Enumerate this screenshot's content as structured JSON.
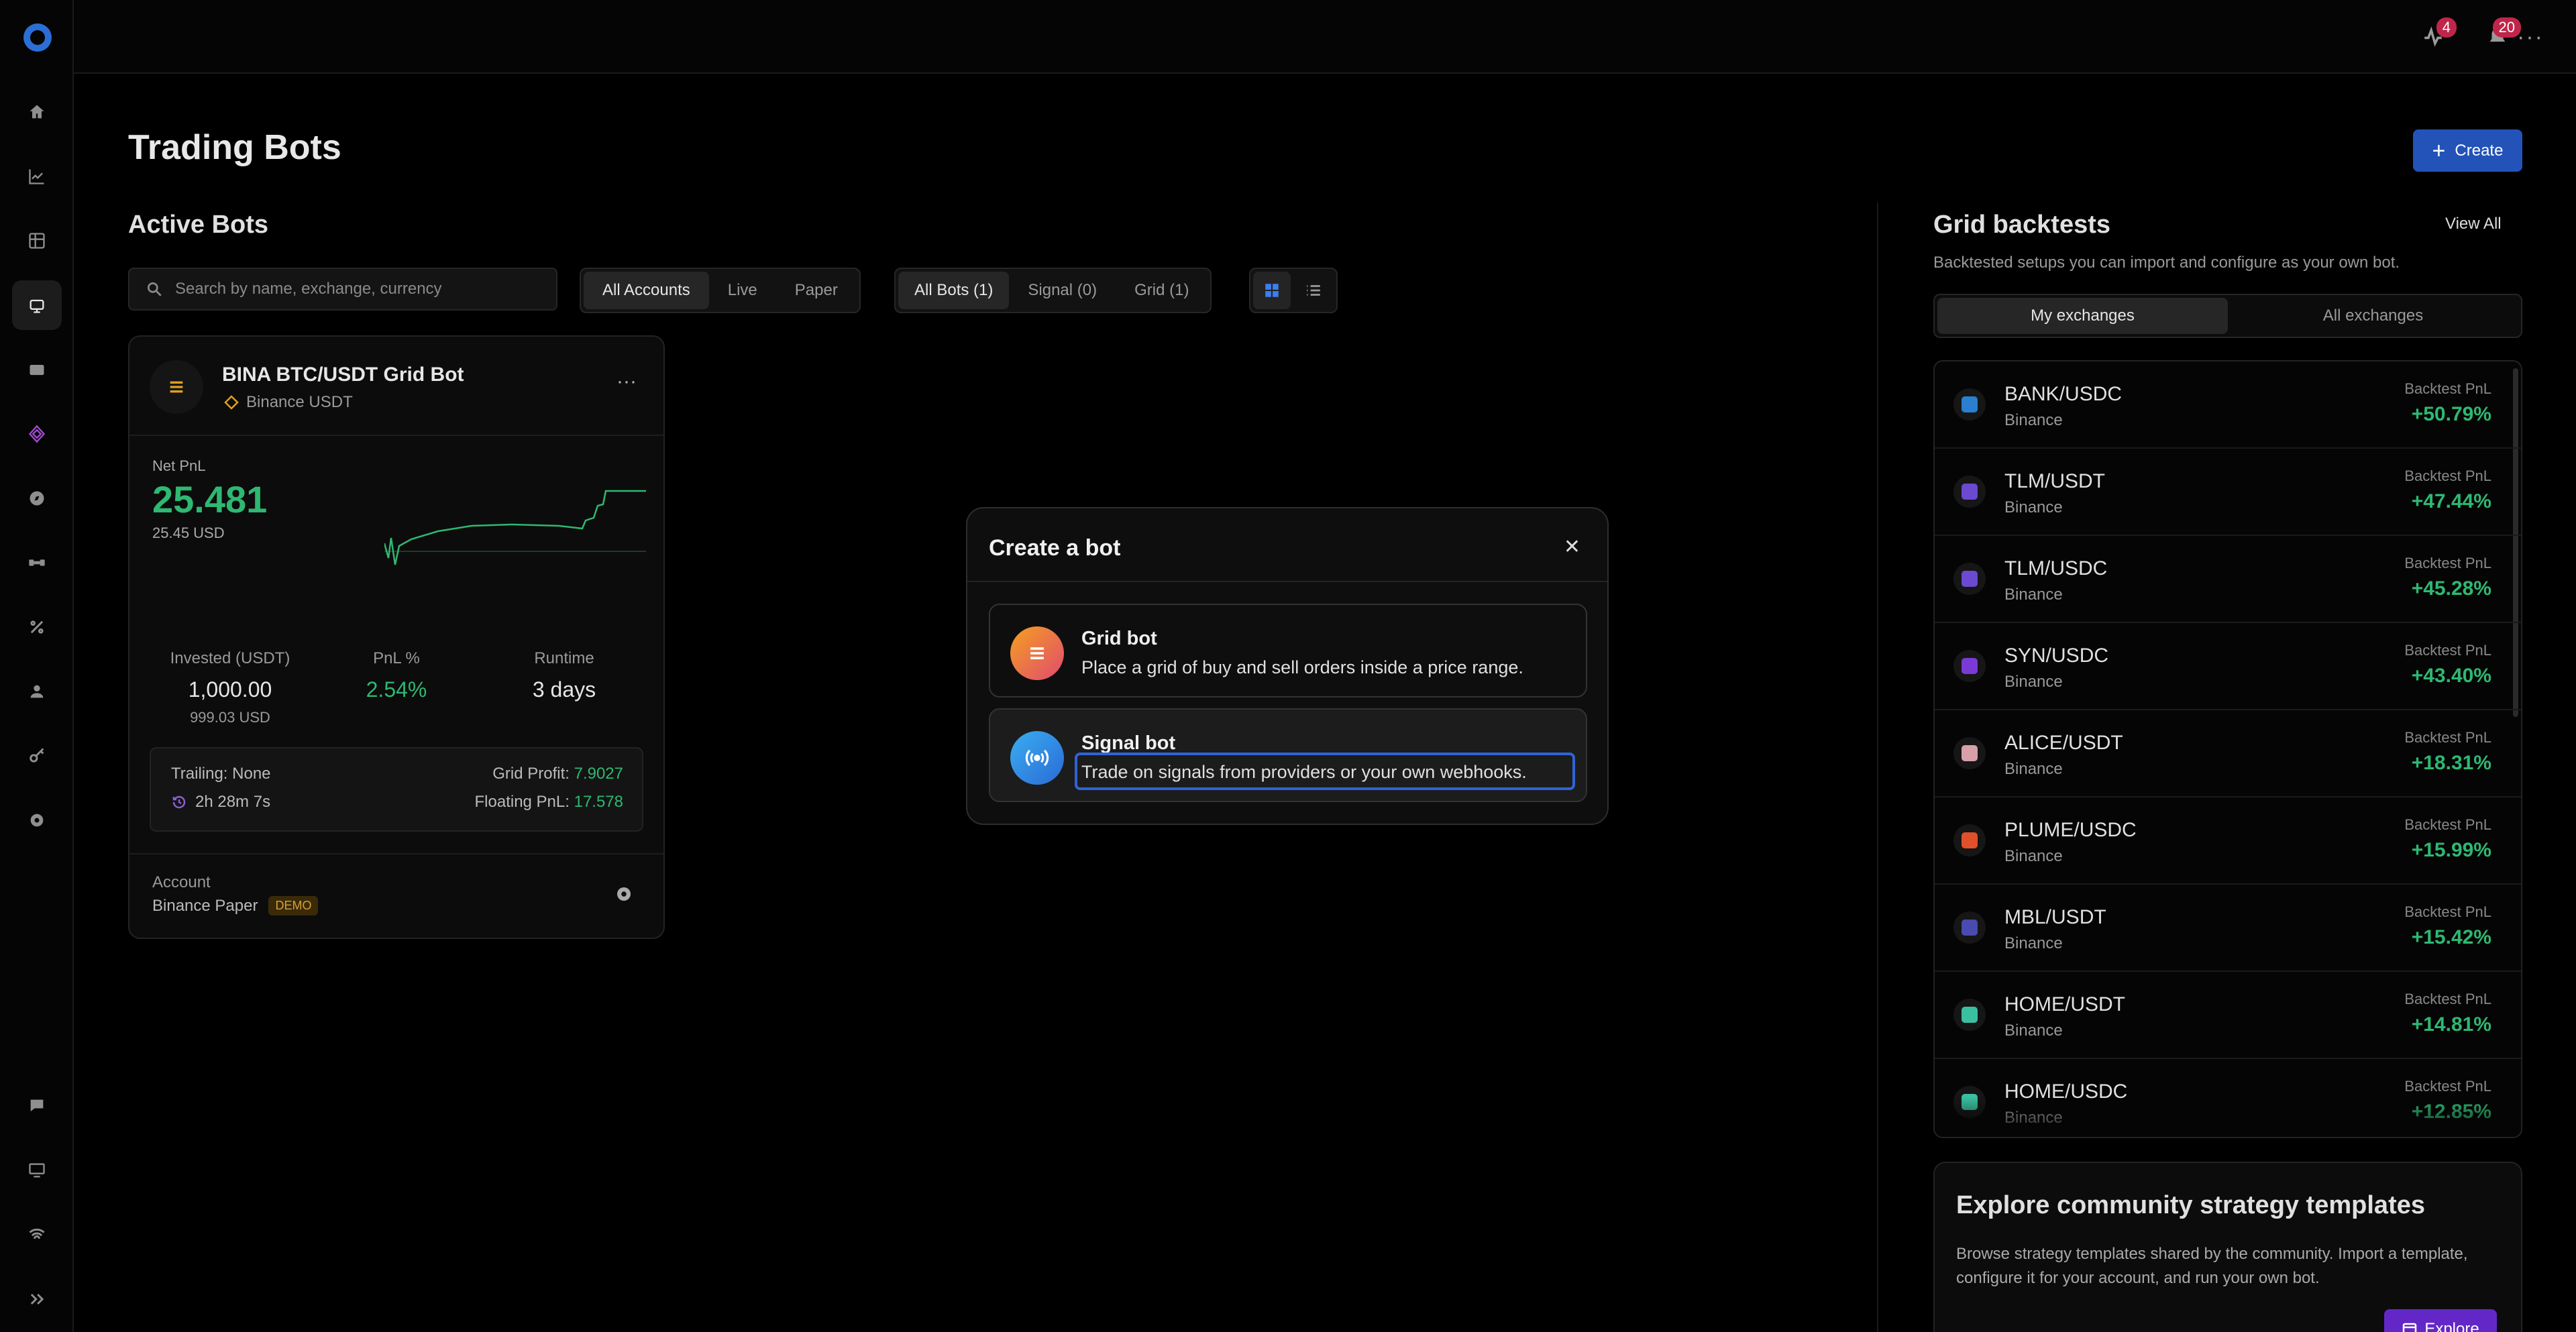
{
  "topbar": {
    "notifications_badge": "4",
    "alerts_badge": "20",
    "more_label": "···"
  },
  "sidebar": {
    "items": [
      {
        "icon": "home-icon"
      },
      {
        "icon": "chart-icon"
      },
      {
        "icon": "grid-icon"
      },
      {
        "icon": "bot-icon",
        "active": true
      },
      {
        "icon": "wallet-icon"
      },
      {
        "icon": "diamond-icon"
      },
      {
        "icon": "compass-icon"
      },
      {
        "icon": "handshake-icon"
      },
      {
        "icon": "percent-icon"
      },
      {
        "icon": "user-icon"
      },
      {
        "icon": "key-icon"
      },
      {
        "icon": "gear-icon"
      }
    ],
    "bottom": [
      {
        "icon": "chat-icon"
      },
      {
        "icon": "monitor-icon"
      },
      {
        "icon": "wifi-icon"
      },
      {
        "icon": "expand-icon"
      }
    ]
  },
  "header": {
    "title": "Trading Bots",
    "create_label": "Create"
  },
  "active_bots": {
    "title": "Active Bots",
    "search_placeholder": "Search by name, exchange, currency",
    "account_filters": [
      "All Accounts",
      "Live",
      "Paper"
    ],
    "bot_filters": [
      "All Bots (1)",
      "Signal (0)",
      "Grid (1)"
    ]
  },
  "bot_card": {
    "name": "BINA BTC/USDT Grid Bot",
    "exchange": "Binance USDT",
    "net_pnl_label": "Net PnL",
    "net_pnl_value": "25.481",
    "net_pnl_usd": "25.45 USD",
    "invested_label": "Invested (USDT)",
    "invested_value": "1,000.00",
    "invested_sub": "999.03 USD",
    "pnl_pct_label": "PnL %",
    "pnl_pct_value": "2.54%",
    "runtime_label": "Runtime",
    "runtime_value": "3 days",
    "trailing": "Trailing: None",
    "grid_profit_label": "Grid Profit:",
    "grid_profit_value": "7.9027",
    "elapsed": "2h 28m 7s",
    "floating_label": "Floating PnL:",
    "floating_value": "17.578",
    "account_label": "Account",
    "account_value": "Binance Paper",
    "account_badge": "DEMO"
  },
  "grid_backtests": {
    "title": "Grid backtests",
    "view_all": "View All",
    "subtitle": "Backtested setups you can import and configure as your own bot.",
    "tabs": [
      "My exchanges",
      "All exchanges"
    ],
    "pnl_label": "Backtest PnL",
    "rows": [
      {
        "pair": "BANK/USDC",
        "exchange": "Binance",
        "pnl": "+50.79%",
        "color": "#2a7fd0"
      },
      {
        "pair": "TLM/USDT",
        "exchange": "Binance",
        "pnl": "+47.44%",
        "color": "#6a4ad0"
      },
      {
        "pair": "TLM/USDC",
        "exchange": "Binance",
        "pnl": "+45.28%",
        "color": "#6a4ad0"
      },
      {
        "pair": "SYN/USDC",
        "exchange": "Binance",
        "pnl": "+43.40%",
        "color": "#7a3ad6"
      },
      {
        "pair": "ALICE/USDT",
        "exchange": "Binance",
        "pnl": "+18.31%",
        "color": "#d8a0a8"
      },
      {
        "pair": "PLUME/USDC",
        "exchange": "Binance",
        "pnl": "+15.99%",
        "color": "#e0502a"
      },
      {
        "pair": "MBL/USDT",
        "exchange": "Binance",
        "pnl": "+15.42%",
        "color": "#4a4ab0"
      },
      {
        "pair": "HOME/USDT",
        "exchange": "Binance",
        "pnl": "+14.81%",
        "color": "#3ac0a0"
      },
      {
        "pair": "HOME/USDC",
        "exchange": "Binance",
        "pnl": "+12.85%",
        "color": "#3ac0a0"
      }
    ]
  },
  "explore": {
    "title": "Explore community strategy templates",
    "description": "Browse strategy templates shared by the community. Import a template, configure it for your account, and run your own bot.",
    "button": "Explore"
  },
  "modal": {
    "title": "Create a bot",
    "options": [
      {
        "title": "Grid bot",
        "description": "Place a grid of buy and sell orders inside a price range."
      },
      {
        "title": "Signal bot",
        "description": "Trade on signals from providers or your own webhooks."
      }
    ]
  },
  "colors": {
    "accent": "#2353b8",
    "profit": "#2eb872",
    "explore": "#6327c7"
  }
}
